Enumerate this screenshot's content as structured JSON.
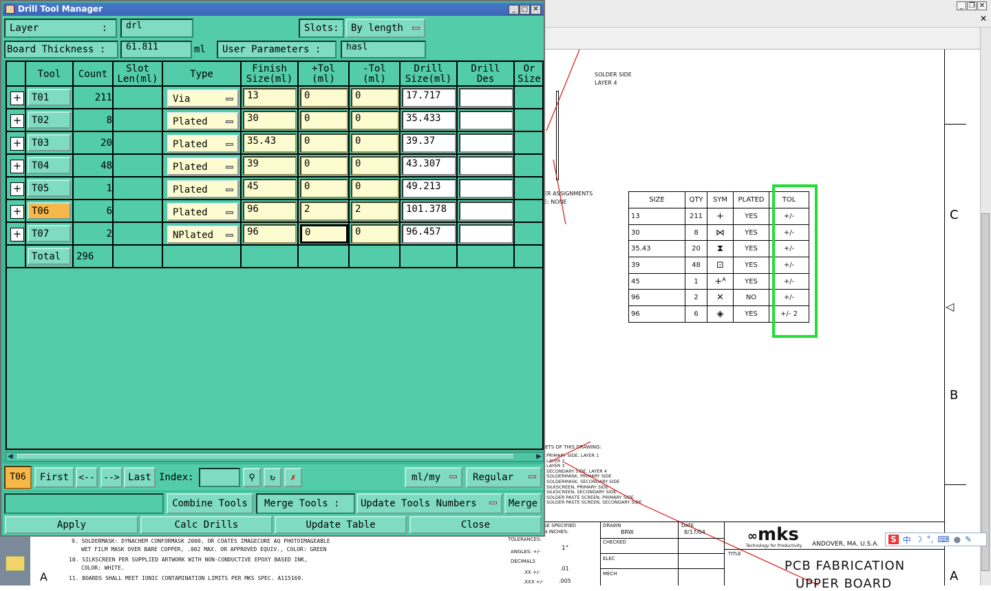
{
  "background_app": {
    "drawing": {
      "solder_side_label": "SOLDER SIDE",
      "layer_label": "LAYER 4",
      "assign_label": "ER ASSIGNMENTS",
      "none_label": "E:  NONE",
      "zone_c": "C",
      "zone_b": "B",
      "zone_a": "A",
      "zone_a_left": "A",
      "sheets_note": "ETS OF THIS DRAWING:",
      "layer_list": [
        "PRIMARY SIDE, LAYER 1",
        "LAYER 2",
        "LAYER 3",
        "SECONDARY SIDE, LAYER 4",
        "SOLDERMASK, PRIMARY SIDE",
        "SOLDERMASK, SECONDARY SIDE",
        "SILKSCREEN, PRIMARY SIDE",
        "SILKSCREEN, SECONDARY SIDE",
        "SOLDER PASTE SCREEN, PRIMARY SIDE",
        "SOLDER PASTE SCREEN, SECONDARY SIDE"
      ],
      "notes": [
        "9.  SOLDERMASK: DYNACHEM CONFORMASK 2000, OR COATES IMAGECURE AQ PHOTOIMAGEABLE",
        "WET FILM MASK OVER BARE COPPER, .002 MAX. OR APPROVED EQUIV., COLOR: GREEN",
        "10. SILKSCREEN PER SUPPLIED ARTWORK WITH NON-CONDUCTIVE EPOXY BASED INK,",
        "COLOR: WHITE.",
        "11. BOARDS SHALL MEET IONIC CONTAMINATION LIMITS PER MKS SPEC. A115169."
      ],
      "title_block": {
        "unless": "SE SPECIFIED",
        "inches": "N INCHES:",
        "tolerances": "TOLERANCES:",
        "angles": "ANGLES: +/-",
        "angle_val": "1°",
        "decimals": "DECIMALS",
        "xx": ".XX  +/-",
        "xx_val": ".01",
        "xxx": ".XXX +/-",
        "xxx_val": ".005",
        "drawn": "DRAWN",
        "drawn_by": "BRW",
        "date": "DATE",
        "date_val": "8/17/04",
        "checked": "CHECKED",
        "elec": "ELEC",
        "mech": "MECH",
        "title": "TITLE",
        "company": "mks",
        "tagline": "Technology for Productivity",
        "location": "ANDOVER, MA. U.S.A.",
        "doc_title": "PCB FABRICATION",
        "doc_title2": "UPPER BOARD"
      }
    },
    "drill_table": {
      "headers": [
        "SIZE",
        "QTY",
        "SYM",
        "PLATED",
        "TOL"
      ],
      "rows": [
        {
          "size": "13",
          "qty": "211",
          "sym": "+",
          "plated": "YES",
          "tol": "+/-"
        },
        {
          "size": "30",
          "qty": "8",
          "sym": "⋈",
          "plated": "YES",
          "tol": "+/-"
        },
        {
          "size": "35.43",
          "qty": "20",
          "sym": "⧗",
          "plated": "YES",
          "tol": "+/-"
        },
        {
          "size": "39",
          "qty": "48",
          "sym": "⊡",
          "plated": "YES",
          "tol": "+/-"
        },
        {
          "size": "45",
          "qty": "1",
          "sym": "+ᴬ",
          "plated": "YES",
          "tol": "+/-"
        },
        {
          "size": "96",
          "qty": "2",
          "sym": "✕",
          "plated": "NO",
          "tol": "+/-"
        },
        {
          "size": "96",
          "qty": "6",
          "sym": "◈",
          "plated": "YES",
          "tol": "+/-  2"
        }
      ]
    },
    "window_buttons": {
      "min": "_",
      "restore": "❐",
      "close": "✕",
      "close2": "✕"
    },
    "ime_bar": {
      "label": "中",
      "items": [
        "S",
        "中",
        "☽",
        "°,",
        "⌨",
        "👤",
        "🔧"
      ]
    }
  },
  "dialog": {
    "title": "Drill Tool Manager",
    "layer_label": "Layer",
    "layer_colon": ":",
    "layer_value": "drl",
    "slots_label": "Slots:",
    "slots_value": "By length",
    "board_thickness_label": "Board Thickness :",
    "board_thickness_value": "61.811",
    "board_thickness_unit": "ml",
    "user_params_label": "User Parameters :",
    "user_params_value": "hasl",
    "columns": [
      "Tool",
      "Count",
      "Slot\nLen(ml)",
      "Type",
      "Finish\nSize(ml)",
      "+Tol\n(ml)",
      "-Tol\n(ml)",
      "Drill\nSize(ml)",
      "Drill\nDes",
      "Or\nSize"
    ],
    "rows": [
      {
        "tool": "T01",
        "count": "211",
        "type": "Via",
        "finish": "13",
        "ptol": "0",
        "ntol": "0",
        "drill": "17.717",
        "des": "",
        "selected": false
      },
      {
        "tool": "T02",
        "count": "8",
        "type": "Plated",
        "finish": "30",
        "ptol": "0",
        "ntol": "0",
        "drill": "35.433",
        "des": "",
        "selected": false
      },
      {
        "tool": "T03",
        "count": "20",
        "type": "Plated",
        "finish": "35.43",
        "ptol": "0",
        "ntol": "0",
        "drill": "39.37",
        "des": "",
        "selected": false
      },
      {
        "tool": "T04",
        "count": "48",
        "type": "Plated",
        "finish": "39",
        "ptol": "0",
        "ntol": "0",
        "drill": "43.307",
        "des": "",
        "selected": false
      },
      {
        "tool": "T05",
        "count": "1",
        "type": "Plated",
        "finish": "45",
        "ptol": "0",
        "ntol": "0",
        "drill": "49.213",
        "des": "",
        "selected": false
      },
      {
        "tool": "T06",
        "count": "6",
        "type": "Plated",
        "finish": "96",
        "ptol": "2",
        "ntol": "2",
        "drill": "101.378",
        "des": "",
        "selected": true
      },
      {
        "tool": "T07",
        "count": "2",
        "type": "NPlated",
        "finish": "96",
        "ptol": "0",
        "ntol": "0",
        "drill": "96.457",
        "des": "",
        "selected": false
      }
    ],
    "total_label": "Total",
    "total_count": "296",
    "current_tool": "T06",
    "nav": {
      "first": "First",
      "prev": "<--",
      "next": "-->",
      "last": "Last",
      "index_label": "Index:",
      "index_value": ""
    },
    "units_value": "ml/my",
    "mode_value": "Regular",
    "combine_tools": "Combine Tools",
    "merge_tools_label": "Merge Tools :",
    "update_tools_numbers": "Update Tools Numbers",
    "merge": "Merge",
    "apply": "Apply",
    "calc_drills": "Calc Drills",
    "update_table": "Update Table",
    "close": "Close"
  }
}
